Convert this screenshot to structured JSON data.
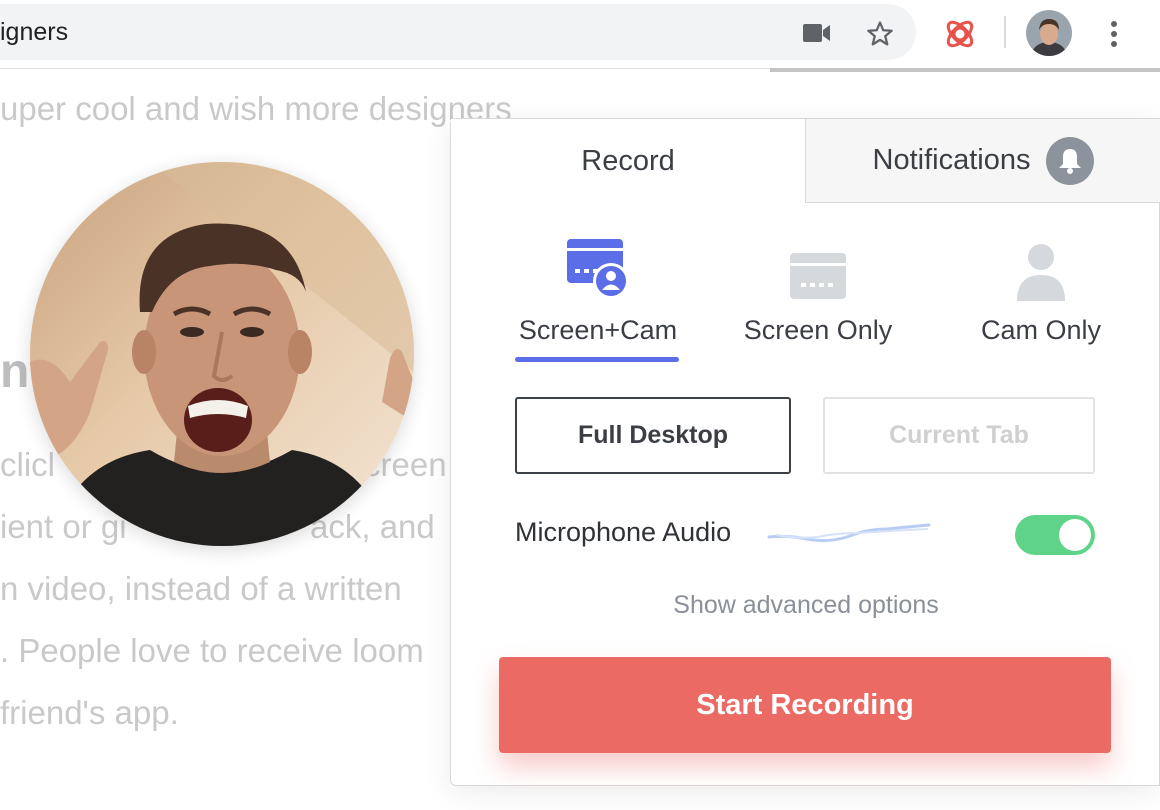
{
  "browser": {
    "address_text": "igners",
    "icons": [
      "video-camera-icon",
      "star-icon",
      "loom-extension-icon",
      "profile-avatar",
      "more-menu-icon"
    ],
    "extension_color": "#e8524a"
  },
  "background_page": {
    "lines": [
      "uper cool and wish more designers",
      "clicl",
      "creen",
      "ient or gi",
      "ack, and",
      "n video, instead of a written",
      ". People love to receive loom",
      "friend's app."
    ],
    "heading_fragment": "nt"
  },
  "popup": {
    "tabs": {
      "record": "Record",
      "notifications": "Notifications"
    },
    "modes": [
      {
        "label": "Screen+Cam",
        "icon": "screen-cam-icon",
        "selected": true
      },
      {
        "label": "Screen Only",
        "icon": "screen-icon",
        "selected": false
      },
      {
        "label": "Cam Only",
        "icon": "person-icon",
        "selected": false
      }
    ],
    "capture": {
      "full_desktop": "Full Desktop",
      "current_tab": "Current Tab",
      "selected": "Full Desktop"
    },
    "microphone": {
      "label": "Microphone Audio",
      "enabled": true
    },
    "advanced_link": "Show advanced options",
    "start_button": "Start Recording"
  },
  "colors": {
    "accent": "#5b6ee8",
    "toggle_on": "#5fd489",
    "start_button": "#eb6a63",
    "inactive_icon": "#d5d8dc"
  }
}
